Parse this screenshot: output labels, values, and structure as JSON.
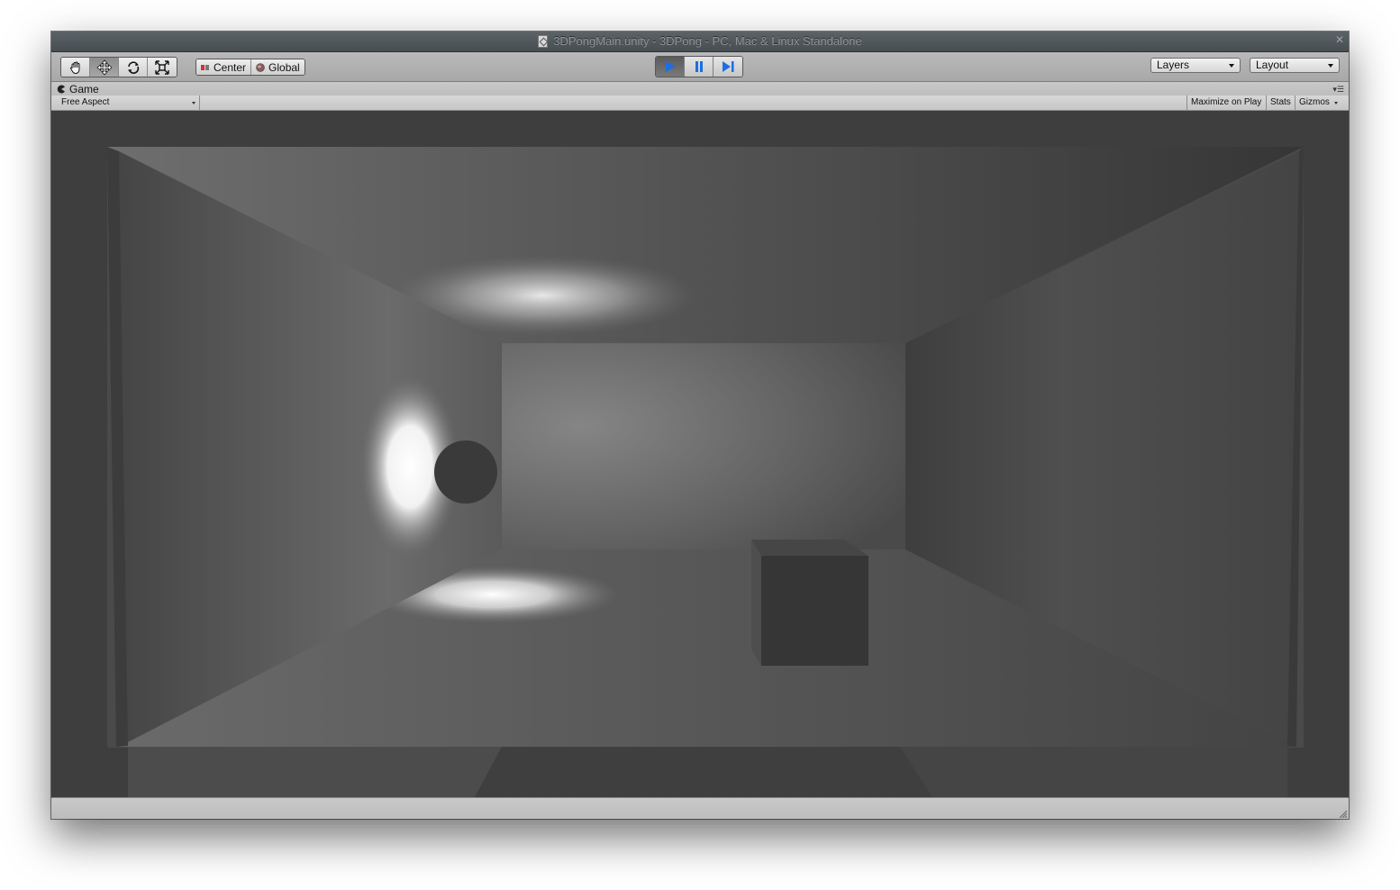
{
  "window": {
    "title": "3DPongMain.unity - 3DPong - PC, Mac & Linux Standalone"
  },
  "toolbar": {
    "transform_tools": [
      {
        "name": "hand-tool",
        "icon": "hand-icon"
      },
      {
        "name": "move-tool",
        "icon": "move-arrows-icon",
        "active": true
      },
      {
        "name": "rotate-tool",
        "icon": "rotate-icon"
      },
      {
        "name": "scale-tool",
        "icon": "scale-icon"
      }
    ],
    "pivot_mode_label": "Center",
    "pivot_rotation_label": "Global",
    "play_controls": [
      {
        "name": "play-button",
        "icon": "play-icon",
        "active": true
      },
      {
        "name": "pause-button",
        "icon": "pause-icon"
      },
      {
        "name": "step-button",
        "icon": "step-icon"
      }
    ],
    "layers_label": "Layers",
    "layout_label": "Layout"
  },
  "game_panel": {
    "tab_label": "Game",
    "aspect_label": "Free Aspect",
    "maximize_on_play_label": "Maximize on Play",
    "stats_label": "Stats",
    "gizmos_label": "Gizmos"
  },
  "colors": {
    "play_blue": "#1b6fe0",
    "titlebar_text": "#8e9498",
    "scene_wall": "#5a5a5a"
  }
}
